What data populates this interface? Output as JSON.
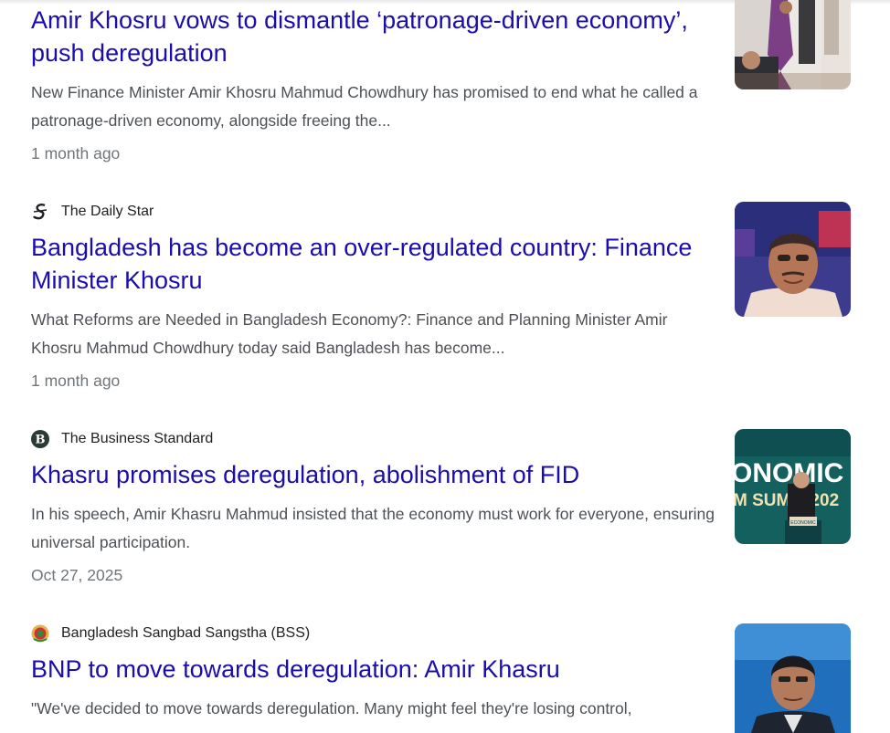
{
  "articles": [
    {
      "headline": "Amir Khosru vows to dismantle ‘patronage-driven economy’, push deregulation",
      "snippet": "New Finance Minister Amir Khosru Mahmud Chowdhury has promised to end what he called a patronage-driven economy, alongside freeing the...",
      "date": "1 month ago"
    },
    {
      "source": "The Daily Star",
      "source_icon": "daily-star-logo-icon",
      "headline": "Bangladesh has become an over-regulated country: Finance Minister Khosru",
      "snippet": "What Reforms are Needed in Bangladesh Economy?: Finance and Planning Minister Amir Khosru Mahmud Chowdhury today said Bangladesh has become...",
      "date": "1 month ago"
    },
    {
      "source": "The Business Standard",
      "source_icon": "business-standard-logo-icon",
      "headline": "Khasru promises deregulation, abolishment of FID",
      "snippet": "In his speech, Amir Khasru Mahmud insisted that the economy must work for everyone, ensuring universal participation.",
      "date": "Oct 27, 2025",
      "thumb_text_1": "ONOMIC",
      "thumb_text_2": "M SUMM 202",
      "thumb_podium": "ECONOMIC"
    },
    {
      "source": "Bangladesh Sangbad Sangstha (BSS)",
      "source_icon": "bss-logo-icon",
      "headline": "BNP to move towards deregulation: Amir Khasru",
      "snippet": "\"We've decided to move towards deregulation. Many might feel they're losing control,"
    }
  ],
  "colors": {
    "headline": "#1a0dab",
    "snippet": "#4d5156",
    "date": "#70757a",
    "source": "#202124"
  }
}
